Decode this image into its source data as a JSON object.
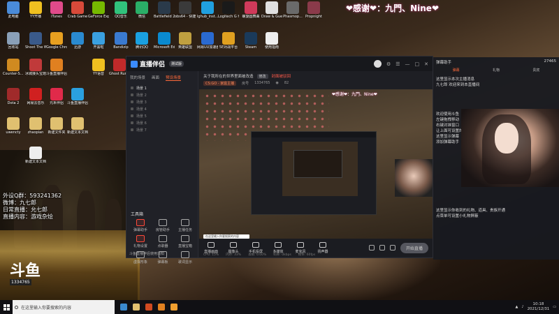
{
  "banner": "❤感谢❤：九門、Nine❤",
  "desktop_icons": [
    {
      "label": "此电脑",
      "color": "#4a8bd9"
    },
    {
      "label": "YY开播",
      "color": "#f0c020"
    },
    {
      "label": "iTunes",
      "color": "#e04a8a"
    },
    {
      "label": "Crab Game",
      "color": "#d84a3a"
    },
    {
      "label": "GeForce Experience",
      "color": "#76b900"
    },
    {
      "label": "QQ音乐",
      "color": "#31c27c"
    },
    {
      "label": "微信",
      "color": "#2aae67"
    },
    {
      "label": "Battlefield 2042 Ope...",
      "color": "#2a3a4a"
    },
    {
      "label": "obs64 - 快捷方式",
      "color": "#3a3a3a"
    },
    {
      "label": "lghub_inst...",
      "color": "#20a0e0"
    },
    {
      "label": "Logitech G HUB",
      "color": "#1a1a1a"
    },
    {
      "label": "螺旋圆舞曲",
      "color": "#d03a5a"
    },
    {
      "label": "Draw & Guess",
      "color": "#e0e0e0"
    },
    {
      "label": "Phasmop...",
      "color": "#6a6a6a"
    },
    {
      "label": "Propnight",
      "color": "#8a3a4a"
    },
    {
      "label": "回收站",
      "color": "#8aa0b8"
    },
    {
      "label": "Shoot The Wire Sour...",
      "color": "#3a5a8a"
    },
    {
      "label": "Google Chrome",
      "color": "#e8a020"
    },
    {
      "label": "迅游",
      "color": "#2a8ad0"
    },
    {
      "label": "开黑啦",
      "color": "#3aa0e0"
    },
    {
      "label": "Bandizip",
      "color": "#3a7ad0"
    },
    {
      "label": "腾讯QQ",
      "color": "#1aa0e0"
    },
    {
      "label": "Microsoft Edge",
      "color": "#0a8ad0"
    },
    {
      "label": "英雄联盟",
      "color": "#c0a040"
    },
    {
      "label": "网易UU加速器",
      "color": "#2a6ad0"
    },
    {
      "label": "5E对战平台",
      "color": "#e0a020"
    },
    {
      "label": "Steam",
      "color": "#1a3a5a"
    },
    {
      "label": "使用指南",
      "color": "#eeeeee"
    },
    {
      "label": "Counter-S... Global Off...",
      "color": "#d08a20"
    },
    {
      "label": "冰城接头宝炮伍",
      "color": "#c03a3a"
    },
    {
      "label": "斗鱼直播伴侣",
      "color": "#e08020"
    },
    {
      "label": "YY语音",
      "color": "#f0c020"
    },
    {
      "label": "Ghost Runner",
      "color": "#c02a2a"
    },
    {
      "label": "永劫无间",
      "color": "#b03030"
    },
    {
      "label": "Dota 2",
      "color": "#a02a2a"
    },
    {
      "label": "网易云音乐",
      "color": "#d02020"
    },
    {
      "label": "元禾伴侣",
      "color": "#e02a4a"
    },
    {
      "label": "斗鱼直播伴侣",
      "color": "#2aa0e0"
    },
    {
      "label": "uwencty",
      "color": "#e0c070"
    },
    {
      "label": "zhaopian",
      "color": "#e0c070"
    },
    {
      "label": "新建文件夹",
      "color": "#e0c070"
    },
    {
      "label": "新建文本文档",
      "color": "#e0c070"
    },
    {
      "label": "新建文本文档 (2)",
      "color": "#eeeeee"
    }
  ],
  "overlay_info": {
    "line1": "外设Q群：593241362",
    "line2": "微博：九七郎",
    "line3": "日常直播：允七郎",
    "line4": "直播内容：游戏杂烩"
  },
  "douyu": {
    "big": "斗鱼",
    "small": "1334765"
  },
  "app": {
    "brand": "直播伴侣",
    "beta": "测试版",
    "left_tabs": [
      "我的场景",
      "画面",
      "设置"
    ],
    "active_left_tab": "预设场景",
    "scene_items": [
      "场景 1",
      "场景 2",
      "场景 3",
      "场景 4",
      "场景 5",
      "场景 6",
      "场景 7"
    ],
    "toolbox_title": "工具箱",
    "tools": [
      {
        "label": "弹幕助手",
        "red": true
      },
      {
        "label": "房管助手",
        "red": false
      },
      {
        "label": "主播任务",
        "red": false
      },
      {
        "label": "礼物设置",
        "red": true
      },
      {
        "label": "点歌器",
        "red": false
      },
      {
        "label": "直播宝箱",
        "red": false
      },
      {
        "label": "虚拟形象",
        "red": false
      },
      {
        "label": "弹幕板",
        "red": false
      },
      {
        "label": "歌词显示",
        "red": false
      }
    ],
    "stream_title": "关于我所在的世界里面被改造",
    "title_chip": "修改",
    "title_warn": "封面被驳回",
    "category": "CS:GO - 家庭主播",
    "room_label": "房号",
    "room_no": "1334765",
    "viewer_icon": "eye-icon",
    "viewers": "82",
    "nested_banner": "❤感谢❤：九門、Nine❤",
    "search_pill": "在这里输入你要搜索的内容",
    "controls": [
      {
        "label": "直播画面",
        "icon": "monitor-icon"
      },
      {
        "label": "摄像头",
        "icon": "camera-icon"
      },
      {
        "label": "手机投屏",
        "icon": "phone-icon"
      },
      {
        "label": "多媒体",
        "icon": "media-icon"
      },
      {
        "label": "麦克风",
        "icon": "mic-icon"
      },
      {
        "label": "扬声器",
        "icon": "speaker-icon"
      }
    ],
    "start_live": "开始直播",
    "notice": "斗鱼直播伴侣使用须知",
    "status": [
      "CPU: 15%",
      "内存: 33%",
      "丢帧: 0.00%",
      "码率: 0kbps",
      "帧率: 60fps"
    ]
  },
  "chat": {
    "title": "弹幕助手",
    "count": "27465",
    "tabs": [
      "弹幕",
      "礼物",
      "贵宾"
    ],
    "lines": [
      "这里显示本次主播消息",
      "九七郎 欢迎来到本直播间",
      "欢迎使用斗鱼",
      "左键拖拽移动",
      "右键对准窗口",
      "让上面可设置的",
      "这里显示弹幕",
      "添加弹幕助手"
    ],
    "footer1": "这里显示你收到的礼物、道具、贵族开通",
    "footer2": "点菜单可设置小礼物屏蔽"
  },
  "taskbar": {
    "search_placeholder": "在这里输入你要搜索的内容",
    "apps": [
      "#3a8ad0",
      "#e0c070",
      "#d04a20",
      "#e08020",
      "#f0a030"
    ],
    "time": "10:18",
    "date": "2021/12/31"
  }
}
